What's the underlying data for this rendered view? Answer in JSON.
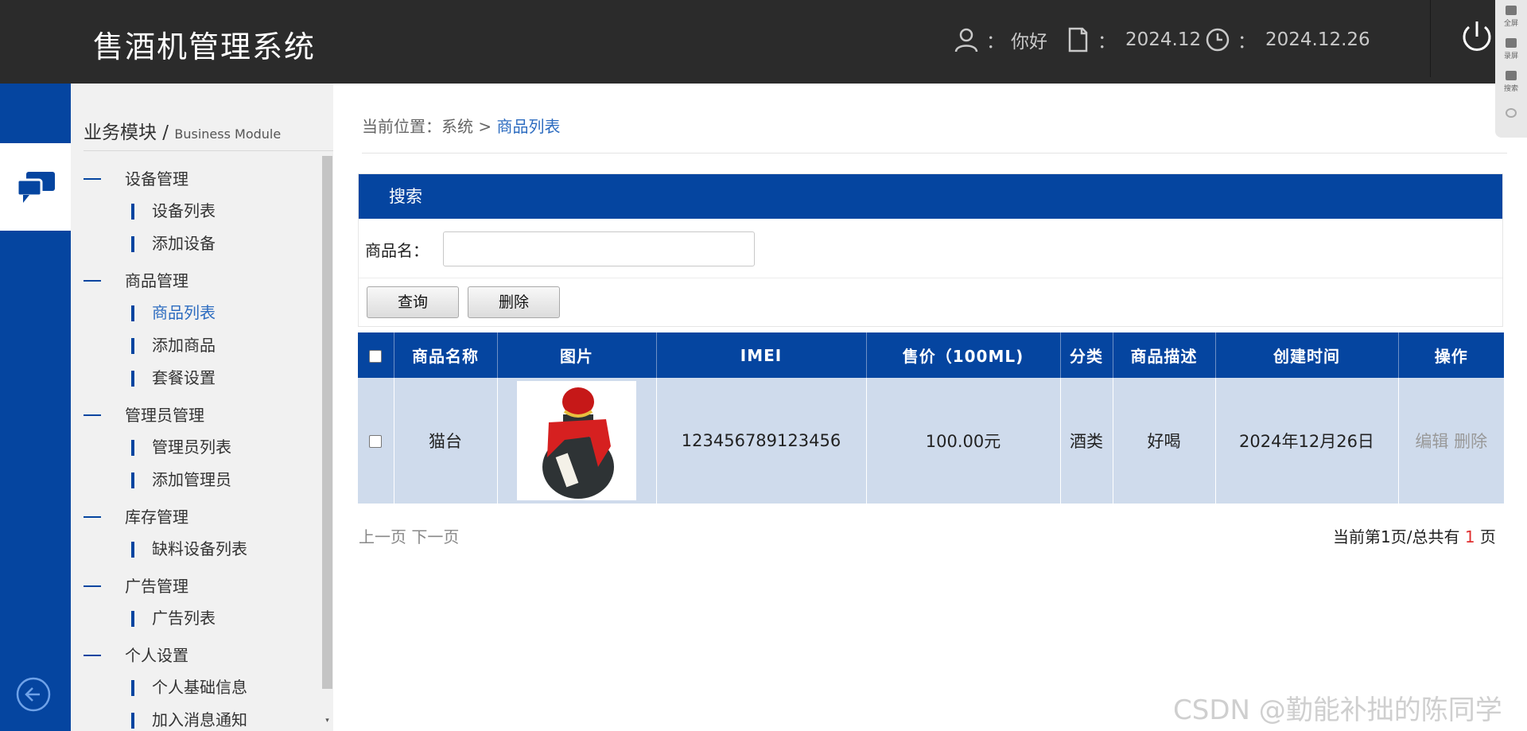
{
  "header": {
    "title": "售酒机管理系统",
    "user_sep": "：",
    "user_name": "你好",
    "month_sep": "：",
    "month": "2024.12",
    "date_sep": "：",
    "date": "2024.12.26"
  },
  "side_tools": [
    {
      "label": "全屏"
    },
    {
      "label": "录屏"
    },
    {
      "label": "搜索"
    },
    {
      "label": ""
    }
  ],
  "sidebar": {
    "module_title": "业务模块 / ",
    "module_title_en": "Business Module",
    "groups": [
      {
        "title": "设备管理",
        "items": [
          "设备列表",
          "添加设备"
        ]
      },
      {
        "title": "商品管理",
        "items": [
          "商品列表",
          "添加商品",
          "套餐设置"
        ]
      },
      {
        "title": "管理员管理",
        "items": [
          "管理员列表",
          "添加管理员"
        ]
      },
      {
        "title": "库存管理",
        "items": [
          "缺料设备列表"
        ]
      },
      {
        "title": "广告管理",
        "items": [
          "广告列表"
        ]
      },
      {
        "title": "个人设置",
        "items": [
          "个人基础信息",
          "加入消息通知"
        ]
      }
    ],
    "active_item": "商品列表"
  },
  "breadcrumb": {
    "prefix": "当前位置：系统 > ",
    "current": "商品列表"
  },
  "search": {
    "heading": "搜索",
    "label": "商品名：",
    "value": "",
    "placeholder": "",
    "query_button": "查询",
    "delete_button": "删除"
  },
  "table": {
    "columns": [
      "商品名称",
      "图片",
      "IMEI",
      "售价（100ML)",
      "分类",
      "商品描述",
      "创建时间",
      "操作"
    ],
    "rows": [
      {
        "name": "猫台",
        "imei": "123456789123456",
        "price": "100.00元",
        "category": "酒类",
        "description": "好喝",
        "created": "2024年12月26日",
        "edit": "编辑",
        "delete": "删除"
      }
    ]
  },
  "pager": {
    "prev": "上一页",
    "next": "下一页",
    "summary_prefix": "当前第1页/总共有 ",
    "total": "1",
    "summary_suffix": " 页"
  },
  "watermark": "CSDN @勤能补拙的陈同学",
  "colors": {
    "header_bg": "#2b2b2b",
    "brand_blue": "#0545a0",
    "row_bg": "#cfdbec",
    "link_blue": "#2d6cc0"
  }
}
